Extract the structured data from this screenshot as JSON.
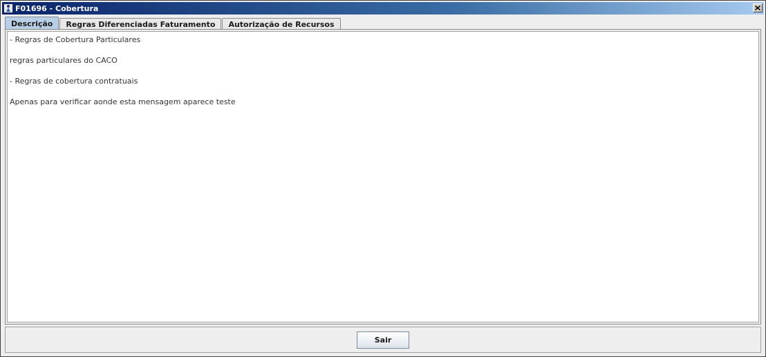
{
  "window": {
    "title": "F01696 - Cobertura",
    "icon": "app-window-icon",
    "close_icon": "close-icon"
  },
  "tabs": [
    {
      "label": "Descrição",
      "active": true
    },
    {
      "label": "Regras Diferenciadas Faturamento",
      "active": false
    },
    {
      "label": "Autorização de Recursos",
      "active": false
    }
  ],
  "description": {
    "lines": [
      "- Regras de Cobertura Particulares",
      "regras particulares do CACO",
      "- Regras de cobertura contratuais",
      "Apenas para verificar aonde esta mensagem aparece teste"
    ]
  },
  "footer": {
    "exit_label": "Sair"
  },
  "colors": {
    "titlebar_start": "#0a246a",
    "titlebar_end": "#a6caf0",
    "active_tab": "#b8cfe5"
  }
}
